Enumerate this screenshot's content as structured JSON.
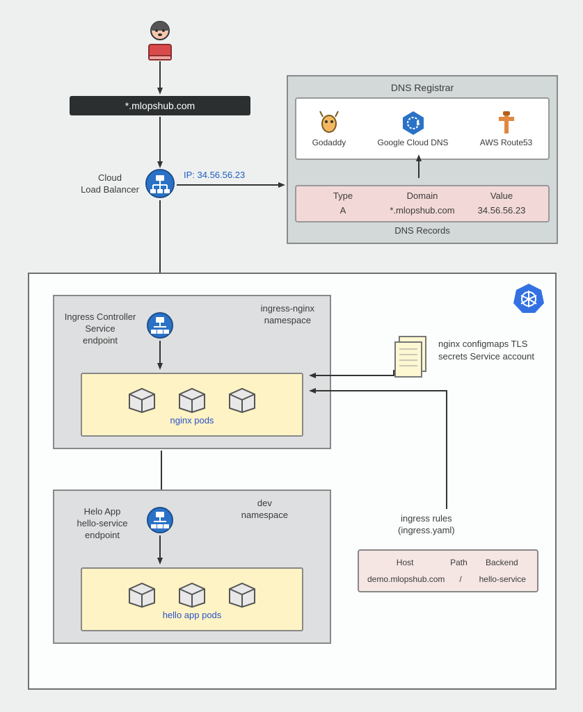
{
  "domain_bar": "*.mlopshub.com",
  "cloud_lb_label": "Cloud\nLoad Balancer",
  "ip_label": "IP: 34.56.56.23",
  "dns_registrar": {
    "title": "DNS Registrar",
    "providers": {
      "godaddy": "Godaddy",
      "gcloud": "Google Cloud DNS",
      "route53": "AWS Route53"
    },
    "records_title": "DNS Records",
    "headers": {
      "type": "Type",
      "domain": "Domain",
      "value": "Value"
    },
    "record": {
      "type": "A",
      "domain": "*.mlopshub.com",
      "value": "34.56.56.23"
    }
  },
  "ns1": {
    "tag": "ingress-nginx\nnamespace",
    "svc_label": "Ingress Controller\nService\nendpoint",
    "pods_label": "nginx pods"
  },
  "ns2": {
    "tag": "dev\nnamespace",
    "svc_label": "Helo App\nhello-service\nendpoint",
    "pods_label": "hello app pods"
  },
  "config_docs": "nginx configmaps\nTLS secrets\nService account",
  "ingress_rules": {
    "title": "ingress rules\n(ingress.yaml)",
    "headers": {
      "host": "Host",
      "path": "Path",
      "backend": "Backend"
    },
    "row": {
      "host": "demo.mlopshub.com",
      "path": "/",
      "backend": "hello-service"
    }
  }
}
